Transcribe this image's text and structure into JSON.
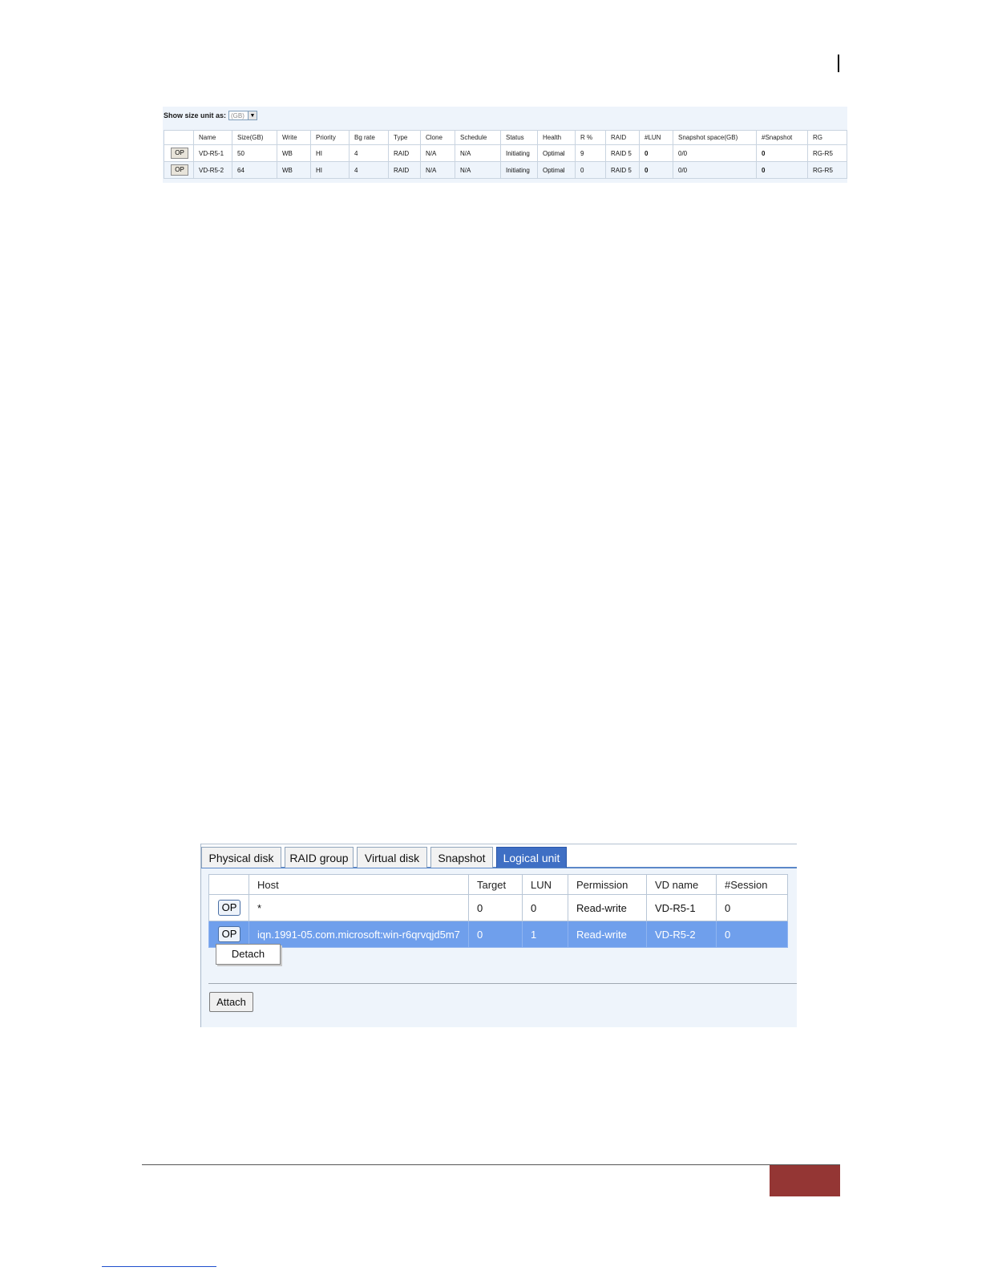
{
  "vd_list": {
    "size_unit_label": "Show size unit as:",
    "size_unit_value": "(GB)",
    "columns": [
      "",
      "Name",
      "Size(GB)",
      "Write",
      "Priority",
      "Bg rate",
      "Type",
      "Clone",
      "Schedule",
      "Status",
      "Health",
      "R %",
      "RAID",
      "#LUN",
      "Snapshot space(GB)",
      "#Snapshot",
      "RG"
    ],
    "rows": [
      {
        "op": "OP",
        "name": "VD-R5-1",
        "size": "50",
        "write": "WB",
        "priority": "HI",
        "bg_rate": "4",
        "type": "RAID",
        "clone": "N/A",
        "schedule": "N/A",
        "status": "Initiating",
        "health": "Optimal",
        "r_pct": "9",
        "raid": "RAID 5",
        "lun": "0",
        "snapshot_space": "0/0",
        "snapshot_count": "0",
        "rg": "RG-R5"
      },
      {
        "op": "OP",
        "name": "VD-R5-2",
        "size": "64",
        "write": "WB",
        "priority": "HI",
        "bg_rate": "4",
        "type": "RAID",
        "clone": "N/A",
        "schedule": "N/A",
        "status": "Initiating",
        "health": "Optimal",
        "r_pct": "0",
        "raid": "RAID 5",
        "lun": "0",
        "snapshot_space": "0/0",
        "snapshot_count": "0",
        "rg": "RG-R5"
      }
    ],
    "colors": {
      "status": "#f08c00",
      "health": "#0a8a0a"
    }
  },
  "lu_panel": {
    "tabs": [
      {
        "label": "Physical disk",
        "active": false
      },
      {
        "label": "RAID group",
        "active": false
      },
      {
        "label": "Virtual disk",
        "active": false
      },
      {
        "label": "Snapshot",
        "active": false
      },
      {
        "label": "Logical unit",
        "active": true
      }
    ],
    "columns": [
      "",
      "Host",
      "Target",
      "LUN",
      "Permission",
      "VD name",
      "#Session"
    ],
    "rows": [
      {
        "op": "OP",
        "host": "*",
        "target": "0",
        "lun": "0",
        "permission": "Read-write",
        "vd_name": "VD-R5-1",
        "session": "0",
        "selected": false
      },
      {
        "op": "OP",
        "host": "iqn.1991-05.com.microsoft:win-r6qrvqjd5m7",
        "target": "0",
        "lun": "1",
        "permission": "Read-write",
        "vd_name": "VD-R5-2",
        "session": "0",
        "selected": true
      }
    ],
    "context_menu": {
      "item": "Detach"
    },
    "attach_label": "Attach",
    "colors": {
      "active_tab": "#3f6fc4",
      "selected_row": "#6f9fec"
    }
  },
  "footer": {
    "page_box_color": "#943634"
  }
}
